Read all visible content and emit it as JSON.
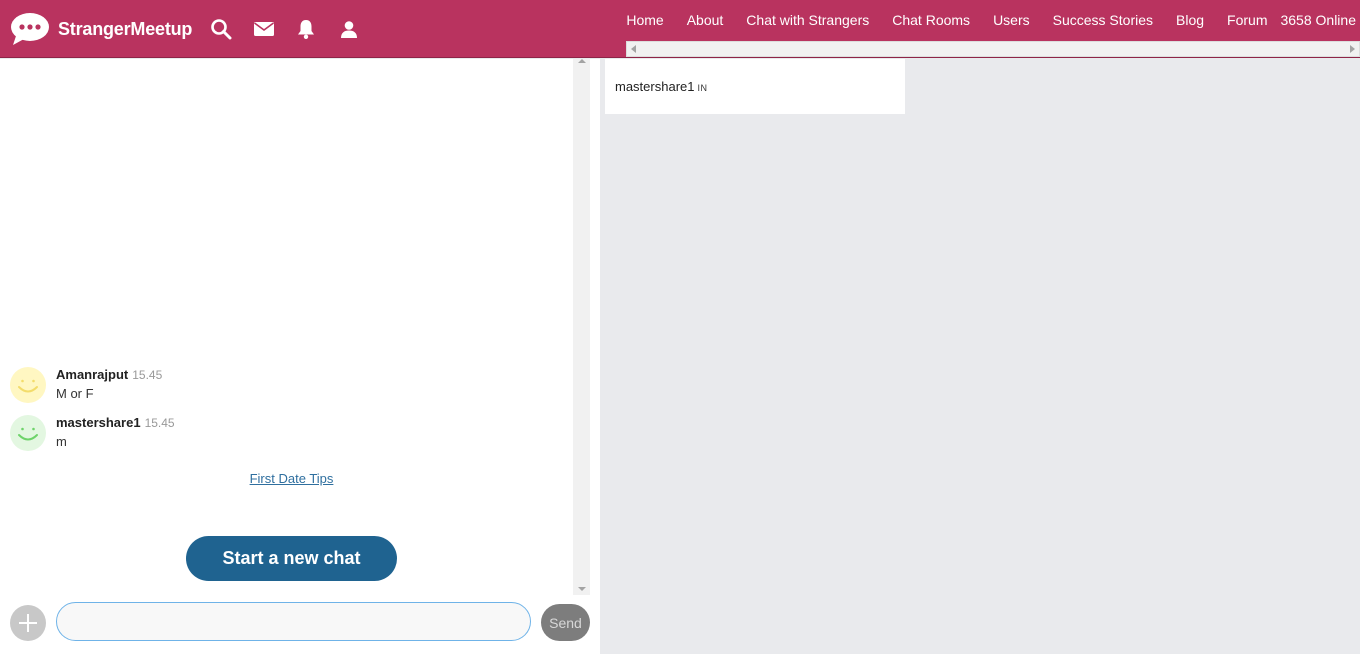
{
  "header": {
    "brand": "StrangerMeetup",
    "icons": [
      "search-icon",
      "mail-icon",
      "bell-icon",
      "user-icon"
    ],
    "nav": [
      "Home",
      "About",
      "Chat with Strangers",
      "Chat Rooms",
      "Users",
      "Success Stories",
      "Blog",
      "Forum"
    ],
    "online": "3658 Online"
  },
  "chat": {
    "messages": [
      {
        "name": "Amanrajput",
        "time": "15.45",
        "text": "M or F",
        "avatar_color": "#fff7c2"
      },
      {
        "name": "mastershare1",
        "time": "15.45",
        "text": "m",
        "avatar_color": "#e3f7e1"
      }
    ],
    "tips_link": "First Date Tips",
    "new_chat_button": "Start a new chat",
    "input_placeholder": "",
    "send_button": "Send"
  },
  "sidebar": {
    "user": {
      "name": "mastershare1",
      "country": "IN"
    }
  },
  "colors": {
    "header_bg": "#b9335f",
    "new_chat_button": "#1f6390",
    "send_button": "#7d7d7d",
    "link": "#2f6f9f"
  }
}
